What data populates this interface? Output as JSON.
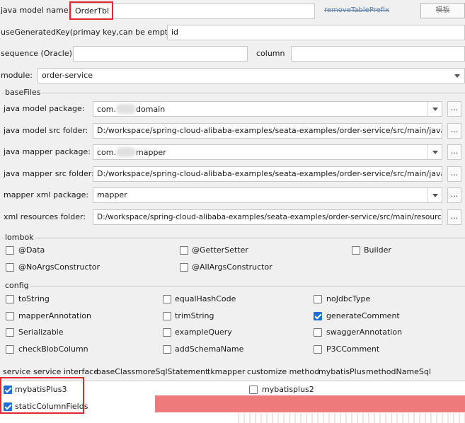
{
  "top": {
    "java_model_name_label": "java model name:",
    "java_model_name_value": "OrderTbl",
    "right_label_struck": "removeTablePrefix",
    "right_button_label": "模板",
    "use_generated_key_label": "useGeneratedKey(primay key,can be empty):",
    "use_generated_key_value": "id",
    "sequence_label": "sequence (Oracle)",
    "sequence_value": "",
    "column_label": "column",
    "column_value": ""
  },
  "module": {
    "label": "module:",
    "value": "order-service"
  },
  "baseFiles": {
    "title": "baseFiles",
    "rows": [
      {
        "label": "java model package:",
        "value_prefix": "com.",
        "value_suffix": "domain",
        "type": "combo"
      },
      {
        "label": "java model src folder:",
        "value": "D:/workspace/spring-cloud-alibaba-examples/seata-examples/order-service/src/main/java",
        "type": "text"
      },
      {
        "label": "java mapper package:",
        "value_prefix": "com.",
        "value_suffix": "mapper",
        "type": "combo"
      },
      {
        "label": "java mapper src folder:",
        "value": "D:/workspace/spring-cloud-alibaba-examples/seata-examples/order-service/src/main/java",
        "type": "text"
      },
      {
        "label": "mapper xml package:",
        "value": "mapper",
        "type": "combo"
      },
      {
        "label": "xml resources folder:",
        "value": "D:/workspace/spring-cloud-alibaba-examples/seata-examples/order-service/src/main/resources",
        "type": "text"
      }
    ],
    "browse_label": "..."
  },
  "lombok": {
    "title": "lombok",
    "items": [
      {
        "label": "@Data",
        "checked": false
      },
      {
        "label": "@GetterSetter",
        "checked": false
      },
      {
        "label": "Builder",
        "checked": false
      },
      {
        "label": "@NoArgsConstructor",
        "checked": false
      },
      {
        "label": "@AllArgsConstructor",
        "checked": false
      }
    ]
  },
  "config": {
    "title": "config",
    "items": [
      {
        "label": "toString",
        "checked": false
      },
      {
        "label": "equalHashCode",
        "checked": false
      },
      {
        "label": "noJdbcType",
        "checked": false
      },
      {
        "label": "mapperAnnotation",
        "checked": false
      },
      {
        "label": "trimString",
        "checked": false
      },
      {
        "label": "generateComment",
        "checked": true
      },
      {
        "label": "Serializable",
        "checked": false
      },
      {
        "label": "exampleQuery",
        "checked": false
      },
      {
        "label": "swaggerAnnotation",
        "checked": false
      },
      {
        "label": "checkBlobColumn",
        "checked": false
      },
      {
        "label": "addSchemaName",
        "checked": false
      },
      {
        "label": "P3CComment",
        "checked": false
      }
    ]
  },
  "tabs": [
    {
      "label": "service",
      "active": false
    },
    {
      "label": "service interface",
      "active": false
    },
    {
      "label": "baseClass",
      "active": false
    },
    {
      "label": "moreSqlStatement",
      "active": false
    },
    {
      "label": "tkmapper",
      "active": false
    },
    {
      "label": "customize method",
      "active": false
    },
    {
      "label": "mybatisPlus",
      "active": true
    },
    {
      "label": "methodNameSql",
      "active": false
    }
  ],
  "mybatisPlus": {
    "items": [
      {
        "label": "mybatisPlus3",
        "checked": true
      },
      {
        "label": "mybatisplus2",
        "checked": false
      },
      {
        "label": "staticColumnFields",
        "checked": true
      }
    ]
  },
  "colors": {
    "accent": "#1e6fd9",
    "highlight_red": "#e0282e",
    "banner_red": "#ef7a7c"
  }
}
